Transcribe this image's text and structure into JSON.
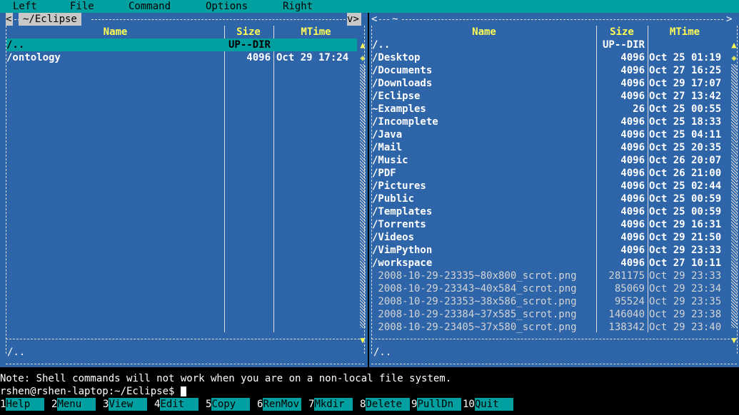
{
  "menubar": {
    "items": [
      "Left",
      "File",
      "Command",
      "Options",
      "Right"
    ]
  },
  "left_panel": {
    "path": "~/Eclipse",
    "corner_left": "<",
    "corner_right": "v>",
    "headers": {
      "name": "Name",
      "size": "Size",
      "mtime": "MTime"
    },
    "rows": [
      {
        "name": "/..",
        "size": "UP--DIR",
        "mtime": "",
        "selected": true,
        "kind": "dir"
      },
      {
        "name": "/ontology",
        "size": "4096",
        "mtime": "Oct 29 17:24",
        "selected": false,
        "kind": "dir"
      }
    ],
    "mini_status": "/.."
  },
  "right_panel": {
    "corner_left": "<",
    "corner_mid": "~",
    "corner_right": ">",
    "headers": {
      "name": "Name",
      "size": "Size",
      "mtime": "MTime"
    },
    "rows": [
      {
        "name": "/..",
        "size": "UP--DIR",
        "mtime": "",
        "kind": "dir"
      },
      {
        "name": "/Desktop",
        "size": "4096",
        "mtime": "Oct 25 01:19",
        "kind": "dir"
      },
      {
        "name": "/Documents",
        "size": "4096",
        "mtime": "Oct 27 16:25",
        "kind": "dir"
      },
      {
        "name": "/Downloads",
        "size": "4096",
        "mtime": "Oct 29 17:07",
        "kind": "dir"
      },
      {
        "name": "/Eclipse",
        "size": "4096",
        "mtime": "Oct 27 13:42",
        "kind": "dir"
      },
      {
        "name": "~Examples",
        "size": "26",
        "mtime": "Oct 25 00:55",
        "kind": "dir"
      },
      {
        "name": "/Incomplete",
        "size": "4096",
        "mtime": "Oct 25 18:33",
        "kind": "dir"
      },
      {
        "name": "/Java",
        "size": "4096",
        "mtime": "Oct 25 04:11",
        "kind": "dir"
      },
      {
        "name": "/Mail",
        "size": "4096",
        "mtime": "Oct 25 20:35",
        "kind": "dir"
      },
      {
        "name": "/Music",
        "size": "4096",
        "mtime": "Oct 26 20:07",
        "kind": "dir"
      },
      {
        "name": "/PDF",
        "size": "4096",
        "mtime": "Oct 26 21:00",
        "kind": "dir"
      },
      {
        "name": "/Pictures",
        "size": "4096",
        "mtime": "Oct 25 02:44",
        "kind": "dir"
      },
      {
        "name": "/Public",
        "size": "4096",
        "mtime": "Oct 25 00:59",
        "kind": "dir"
      },
      {
        "name": "/Templates",
        "size": "4096",
        "mtime": "Oct 25 00:59",
        "kind": "dir"
      },
      {
        "name": "/Torrents",
        "size": "4096",
        "mtime": "Oct 29 16:31",
        "kind": "dir"
      },
      {
        "name": "/Videos",
        "size": "4096",
        "mtime": "Oct 29 21:50",
        "kind": "dir"
      },
      {
        "name": "/VimPython",
        "size": "4096",
        "mtime": "Oct 29 23:33",
        "kind": "dir"
      },
      {
        "name": "/workspace",
        "size": "4096",
        "mtime": "Oct 27 10:11",
        "kind": "dir"
      },
      {
        "name": " 2008-10-29-23335~80x800_scrot.png",
        "size": "281175",
        "mtime": "Oct 29 23:33",
        "kind": "file"
      },
      {
        "name": " 2008-10-29-23343~40x584_scrot.png",
        "size": "85069",
        "mtime": "Oct 29 23:34",
        "kind": "file"
      },
      {
        "name": " 2008-10-29-23353~38x586_scrot.png",
        "size": "95524",
        "mtime": "Oct 29 23:35",
        "kind": "file"
      },
      {
        "name": " 2008-10-29-23384~37x585_scrot.png",
        "size": "146040",
        "mtime": "Oct 29 23:38",
        "kind": "file"
      },
      {
        "name": " 2008-10-29-23405~37x580_scrot.png",
        "size": "138342",
        "mtime": "Oct 29 23:40",
        "kind": "file"
      }
    ],
    "mini_status": "/.."
  },
  "note": "Note: Shell commands will not work when you are on a non-local file system.",
  "prompt": "rshen@rshen-laptop:~/Eclipse$ ",
  "fkeys": [
    {
      "num": "1",
      "label": "Help"
    },
    {
      "num": "2",
      "label": "Menu"
    },
    {
      "num": "3",
      "label": "View"
    },
    {
      "num": "4",
      "label": "Edit"
    },
    {
      "num": "5",
      "label": "Copy"
    },
    {
      "num": "6",
      "label": "RenMov"
    },
    {
      "num": "7",
      "label": "Mkdir"
    },
    {
      "num": "8",
      "label": "Delete"
    },
    {
      "num": "9",
      "label": "PullDn"
    },
    {
      "num": "10",
      "label": "Quit"
    }
  ],
  "colors": {
    "panel_bg": "#2e64a8",
    "accent": "#00a0a0",
    "header_text": "#ffff55",
    "terminal_bg": "#000000"
  }
}
